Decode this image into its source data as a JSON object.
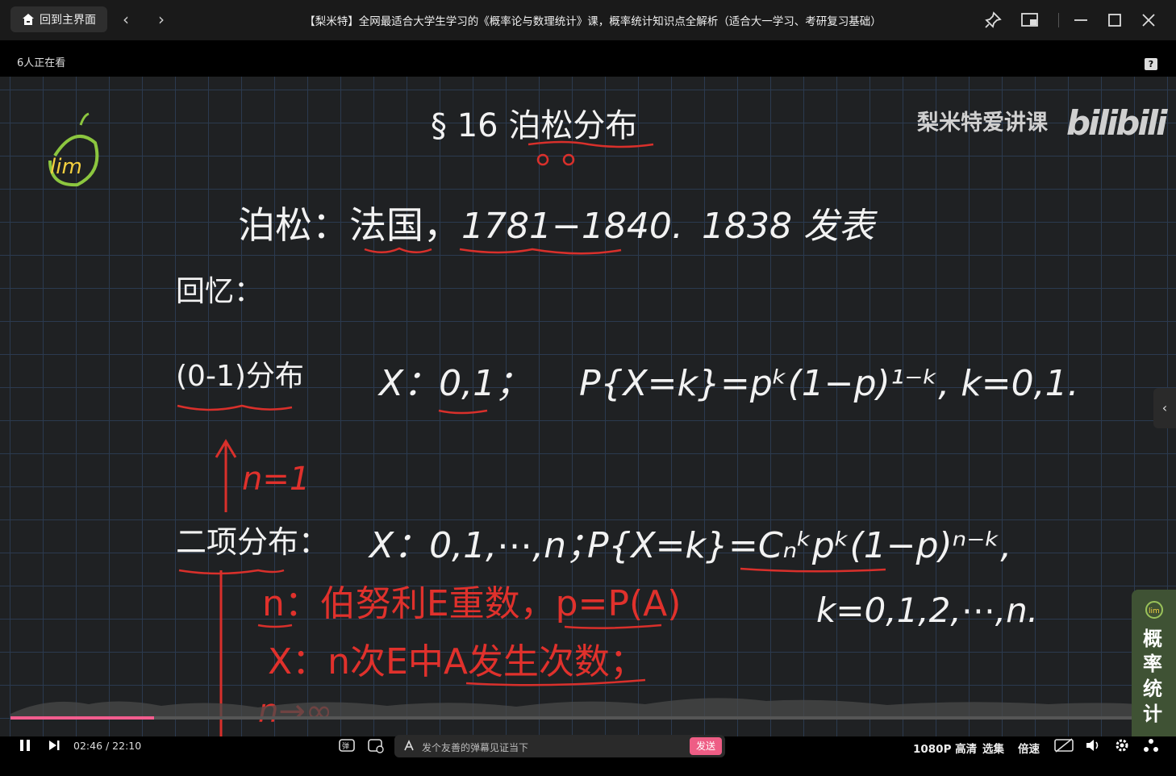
{
  "window": {
    "home_label": "回到主界面",
    "title": "【梨米特】全网最适合大学生学习的《概率论与数理统计》课，概率统计知识点全解析（适合大一学习、考研复习基础）"
  },
  "info": {
    "watchers": "6人正在看",
    "help": "?"
  },
  "slide": {
    "heading": "§ 16  泊松分布",
    "brand": "梨米特爱讲课",
    "bilibili": "bilibili",
    "line1_name": "泊松：法国，",
    "line1_years": "1781−1840.",
    "line1_pub": "1838 发表",
    "recall": "回忆：",
    "bernoulli_label": "(0-1)分布",
    "bernoulli_x": "X：0,1；",
    "bernoulli_p": "P{X=k}=pᵏ(1−p)¹⁻ᵏ, k=0,1.",
    "n1": "n=1",
    "binomial_label": "二项分布：",
    "binomial_x": "X：0,1,⋯,n；",
    "binomial_p": "P{X=k}=Cₙᵏpᵏ(1−p)ⁿ⁻ᵏ,",
    "binomial_k": "k=0,1,2,⋯,n.",
    "red_n": "n：伯努利E重数，p=P(A)",
    "red_x": "X：n次E中A发生次数；",
    "red_inf": "n→∞"
  },
  "side_badge": {
    "text": "概率统计"
  },
  "controls": {
    "time": "02:46 / 22:10",
    "progress": 0.125,
    "danmaku_placeholder": "发个友善的弹幕见证当下",
    "send": "发送",
    "quality": "1080P 高清",
    "episodes": "选集",
    "speed": "倍速"
  }
}
